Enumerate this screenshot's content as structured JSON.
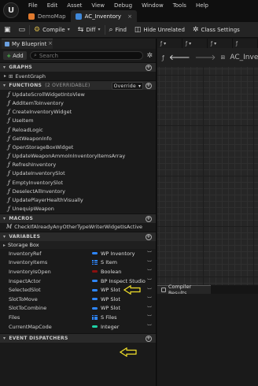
{
  "menu": [
    "File",
    "Edit",
    "Asset",
    "View",
    "Debug",
    "Window",
    "Tools",
    "Help"
  ],
  "tabs": [
    {
      "label": "DemoMap",
      "color": "#e07a2e"
    },
    {
      "label": "AC_Inventory",
      "color": "#3f88d9"
    }
  ],
  "toolbar": {
    "compile": "Compile",
    "diff": "Diff",
    "find": "Find",
    "hide_unrelated": "Hide Unrelated",
    "class_settings": "Class Settings"
  },
  "panel": {
    "tab_label": "My Blueprint",
    "add_label": "Add",
    "search_placeholder": "Search"
  },
  "sections": {
    "graphs": "GRAPHS",
    "functions": "FUNCTIONS",
    "functions_count": "(2 OVERRIDABLE)",
    "override": "Override",
    "macros": "MACROS",
    "variables": "VARIABLES",
    "event_dispatchers": "EVENT DISPATCHERS"
  },
  "graphs": [
    "EventGraph"
  ],
  "functions": [
    "UpdateScrollWidgetIntoView",
    "AddItemToInventory",
    "CreateInventoryWidget",
    "UseItem",
    "ReloadLogic",
    "GetWeaponInfo",
    "OpenStorageBoxWidget",
    "UpdateWeaponAmmoInInventoryItemsArray",
    "RefreshInventory",
    "UpdateInventorySlot",
    "EmptyInventorySlot",
    "DeselectAllInventory",
    "UpdatePlayerHealthVisually",
    "UnequipWeapon"
  ],
  "macros": [
    "CheckIfAlreadyAnyOtherTypeWriterWidgetIsActive"
  ],
  "variable_category": "Storage Box",
  "variables": [
    {
      "name": "InventoryRef",
      "type": "WP Inventory",
      "kind": "pill",
      "color": "#2e86ff"
    },
    {
      "name": "InventoryItems",
      "type": "S Item",
      "kind": "array",
      "color": "#2e86ff"
    },
    {
      "name": "InventoryIsOpen",
      "type": "Boolean",
      "kind": "pill",
      "color": "#8b1010"
    },
    {
      "name": "InspectActor",
      "type": "BP Inspect Studio",
      "kind": "pill",
      "color": "#2e86ff"
    },
    {
      "name": "SelectedSlot",
      "type": "WP Slot",
      "kind": "pill",
      "color": "#2e86ff"
    },
    {
      "name": "SlotToMove",
      "type": "WP Slot",
      "kind": "pill",
      "color": "#2e86ff"
    },
    {
      "name": "SlotToCombine",
      "type": "WP Slot",
      "kind": "pill",
      "color": "#2e86ff"
    },
    {
      "name": "Files",
      "type": "S Files",
      "kind": "array",
      "color": "#2e86ff"
    },
    {
      "name": "CurrentMapCode",
      "type": "Integer",
      "kind": "pill",
      "color": "#1fd3a6"
    }
  ],
  "graph": {
    "breadcrumb": "AC_Inven"
  },
  "compiler": {
    "tab_label": "Compiler Results"
  },
  "colors": {
    "accent_yellow": "#f1e02a"
  }
}
